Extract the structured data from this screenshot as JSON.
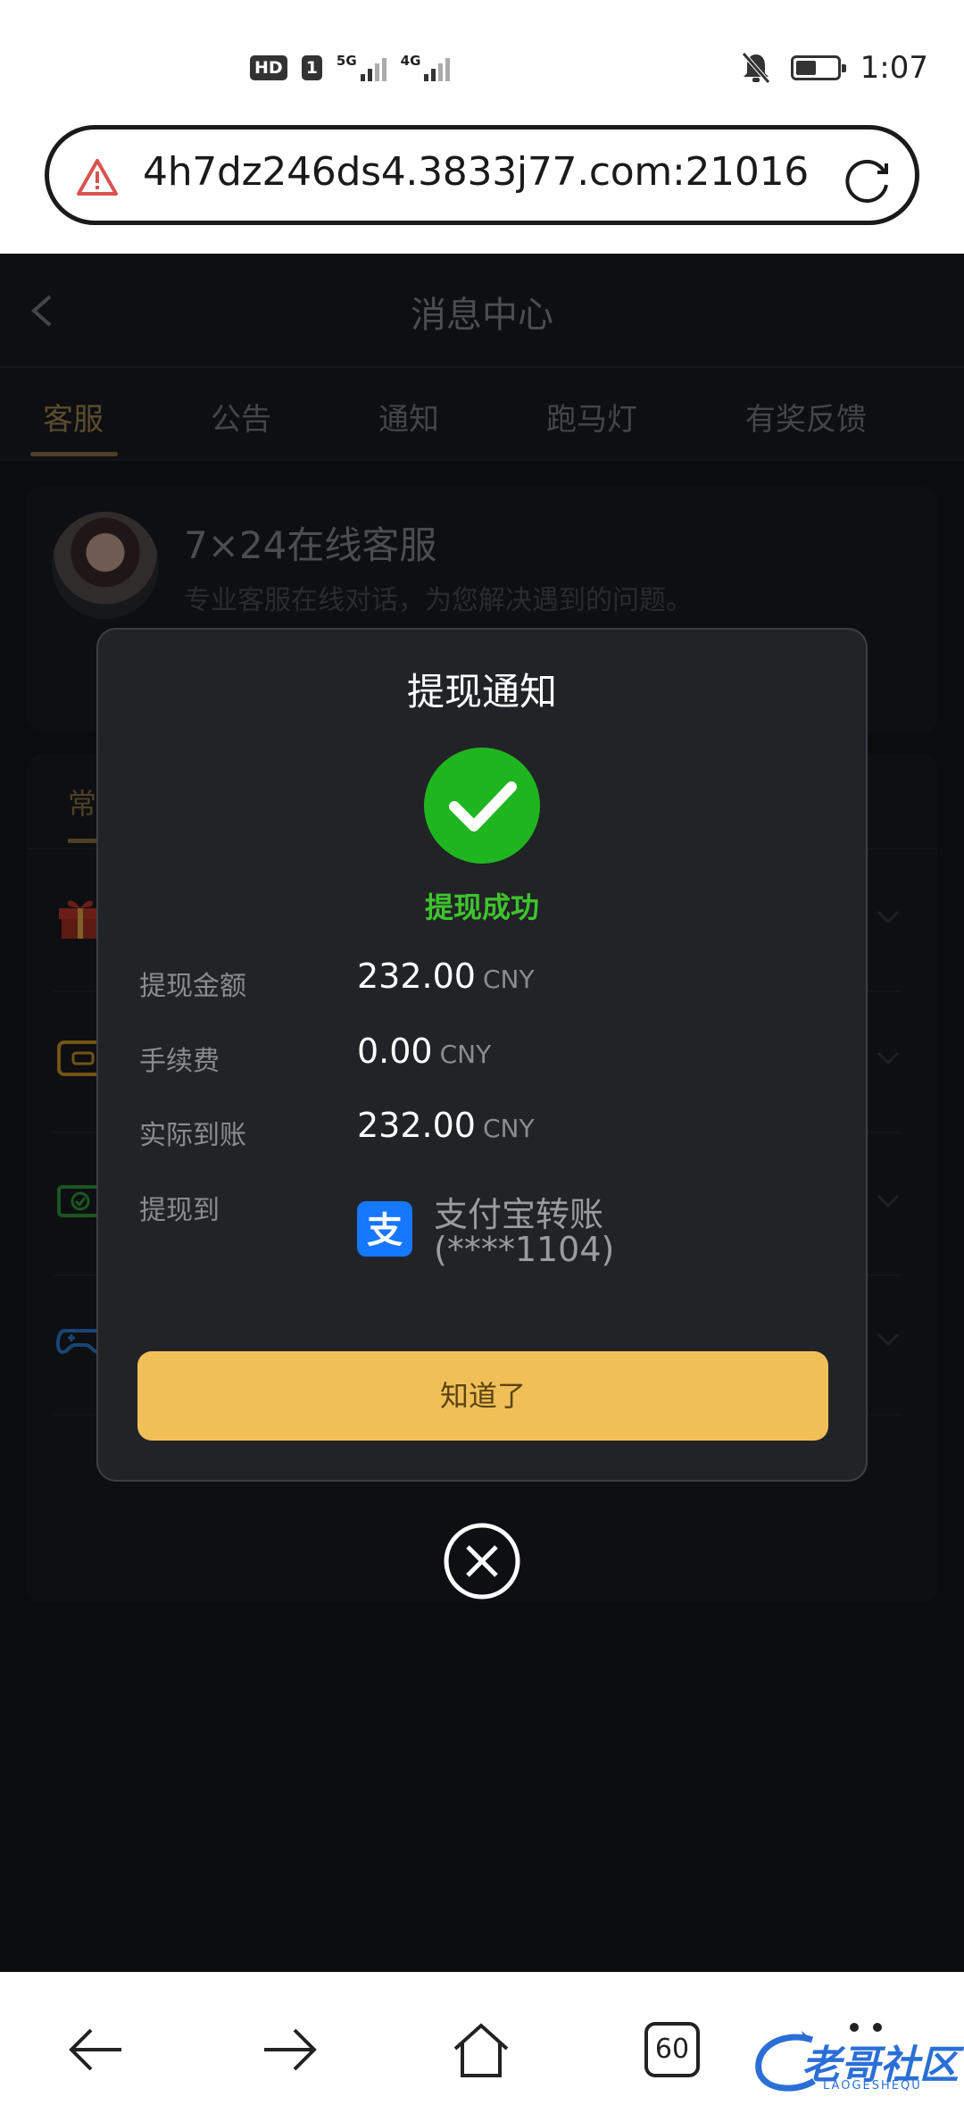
{
  "status_bar": {
    "hd_label": "HD",
    "sim_label": "1",
    "network1": "5G",
    "network2": "4G",
    "time": "1:07",
    "battery_level": 0.5
  },
  "browser": {
    "url": "4h7dz246ds4.3833j77.com:21016",
    "tab_count": "60"
  },
  "app": {
    "title": "消息中心",
    "tabs": [
      {
        "label": "客服"
      },
      {
        "label": "公告"
      },
      {
        "label": "通知"
      },
      {
        "label": "跑马灯"
      },
      {
        "label": "有奖反馈"
      }
    ],
    "active_tab": "客服"
  },
  "service": {
    "title": "7×24在线客服",
    "desc": "专业客服在线对话，为您解决遇到的问题。",
    "section_tab": "常"
  },
  "modal": {
    "title": "提现通知",
    "status": "提现成功",
    "rows": [
      {
        "label": "提现金额",
        "value": "232.00",
        "unit": "CNY"
      },
      {
        "label": "手续费",
        "value": "0.00",
        "unit": "CNY"
      },
      {
        "label": "实际到账",
        "value": "232.00",
        "unit": "CNY"
      }
    ],
    "dest_label": "提现到",
    "dest_name": "支付宝转账",
    "dest_account": "(****1104)",
    "button": "知道了",
    "alipay_glyph": "支"
  },
  "watermark": {
    "text": "老哥社区",
    "sub": "LAOGESHEQU"
  },
  "colors": {
    "accent": "#f0bf57",
    "success": "#3ec42c",
    "alipay": "#1677ff",
    "background": "#14161b"
  }
}
